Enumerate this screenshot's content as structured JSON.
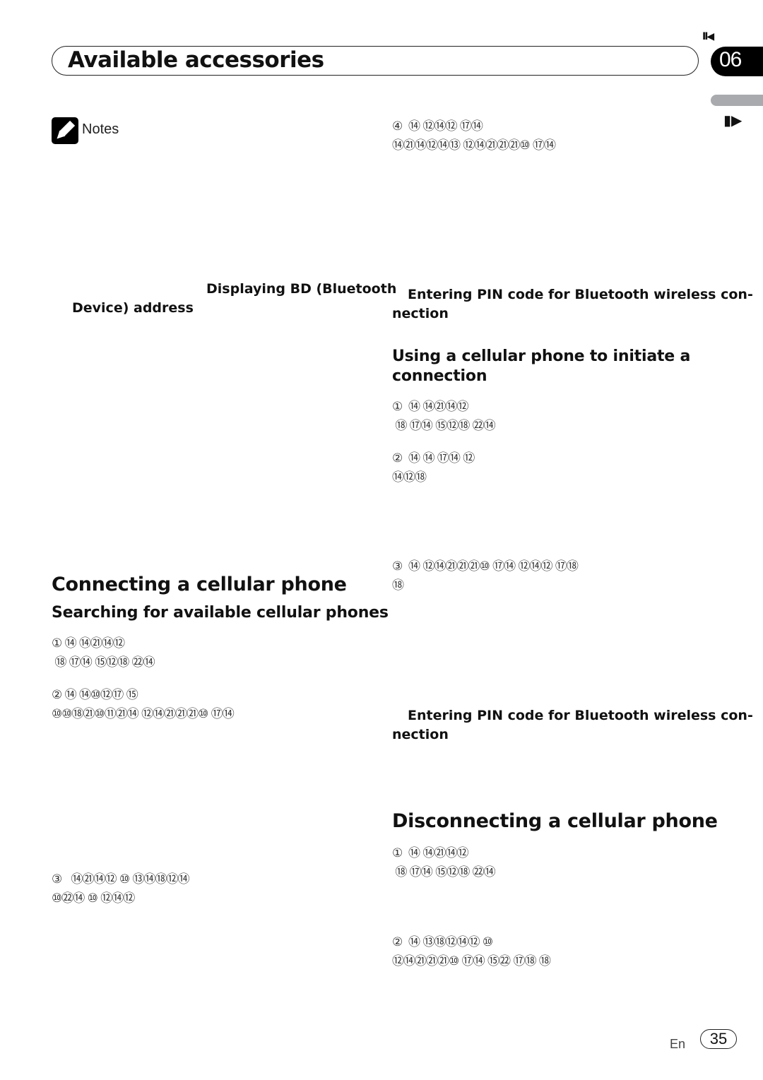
{
  "header": {
    "title": "Available accessories",
    "chapter_number": "06",
    "prev_icon": "II◀",
    "next_icon": "▮▶"
  },
  "notes": {
    "icon": "pencil-icon",
    "label": "Notes"
  },
  "left_column": {
    "bd_address_line1": "Displaying BD (Bluetooth",
    "bd_address_line2": "Device) address",
    "section_title": "Connecting a cellular phone",
    "subsection_title": "Searching for available cellular phones",
    "steps": [
      {
        "line1": "① ⑭ ⑭㉑⑭⑫",
        "line2": " ⑱ ⑰⑭ ⑮⑫⑱ ㉒⑭"
      },
      {
        "line1": "② ⑭ ⑭⑩⑫⑰ ⑮",
        "line2": "⑩⑩⑱㉑⑩⑪㉑⑭ ⑫⑭㉑㉑㉑⑩ ⑰⑭"
      },
      {
        "line1": "③   ⑭㉑⑭⑫ ⑩ ⑬⑭⑱⑫⑭",
        "line2": "⑩㉒⑭ ⑩ ⑫⑭⑫"
      }
    ]
  },
  "right_column": {
    "step4": {
      "line1": "④  ⑭ ⑫⑭⑫ ⑰⑭",
      "line2": "⑭㉑⑭⑫⑭⑬ ⑫⑭㉑㉑㉑⑩ ⑰⑭"
    },
    "pin_ref_1_line1": "Entering PIN code for Bluetooth wireless con-",
    "pin_ref_1_line2": "nection",
    "subsection_title": "Using a cellular phone to initiate a connection",
    "subsection_title_line1": "Using a cellular phone to initiate a",
    "subsection_title_line2": "connection",
    "initiate_steps": [
      {
        "line1": "①  ⑭ ⑭㉑⑭⑫",
        "line2": " ⑱ ⑰⑭ ⑮⑫⑱ ㉒⑭"
      },
      {
        "line1": "②  ⑭ ⑭ ⑰⑭ ⑫",
        "line2": "⑭⑫⑱"
      },
      {
        "line1": "③  ⑭ ⑫⑭㉑㉑㉑⑩ ⑰⑭ ⑫⑭⑫ ⑰⑱",
        "line2": "⑱"
      }
    ],
    "pin_ref_2_line1": "Entering PIN code for Bluetooth wireless con-",
    "pin_ref_2_line2": "nection",
    "section_title": "Disconnecting a cellular phone",
    "disconnect_steps": [
      {
        "line1": "①  ⑭ ⑭㉑⑭⑫",
        "line2": " ⑱ ⑰⑭ ⑮⑫⑱ ㉒⑭"
      },
      {
        "line1": "②  ⑭ ⑬⑱⑫⑭⑫ ⑩",
        "line2": "⑫⑭㉑㉑㉑⑩ ⑰⑭ ⑮㉒ ⑰⑱ ⑱"
      }
    ]
  },
  "footer": {
    "language": "En",
    "page_number": "35"
  }
}
